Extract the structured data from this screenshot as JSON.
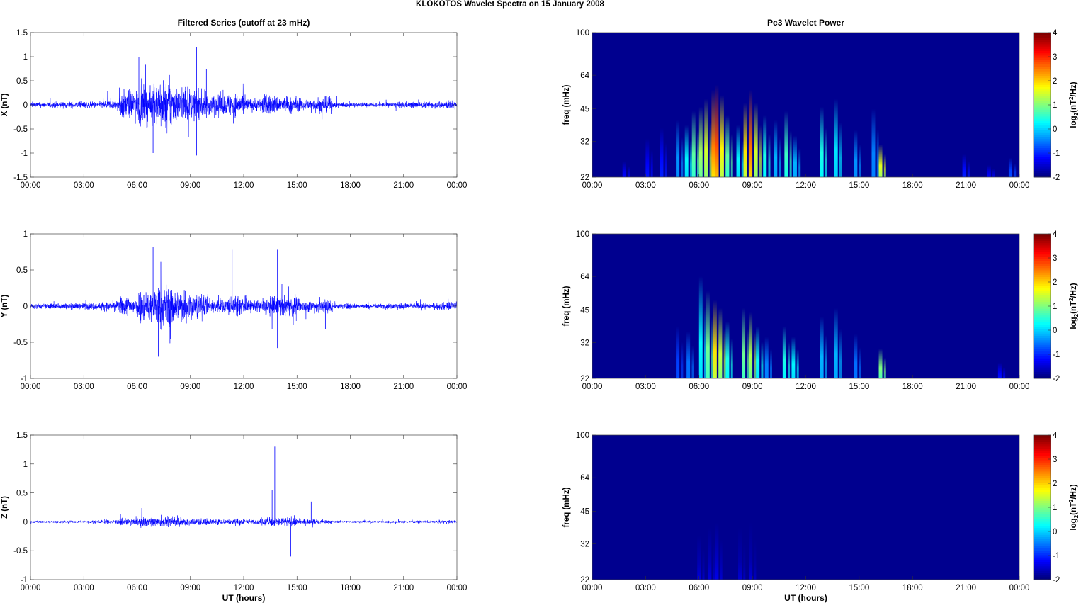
{
  "title": "KLOKOTOS Wavelet Spectra on 15 January   2008",
  "chart_data": [
    {
      "type": "line",
      "title": "Filtered Series (cutoff at 23 mHz)",
      "ylabel": "X (nT)",
      "xlabel": "",
      "ylim": [
        -1.5,
        1.5
      ],
      "yticks": [
        "-1.5",
        "-1",
        "-0.5",
        "0",
        "0.5",
        "1",
        "1.5"
      ],
      "yvals": [
        -1.5,
        -1,
        -0.5,
        0,
        0.5,
        1,
        1.5
      ],
      "xticks": [
        "00:00",
        "03:00",
        "06:00",
        "09:00",
        "12:00",
        "15:00",
        "18:00",
        "21:00",
        "00:00"
      ],
      "envelope_hourly": [
        0.08,
        0.09,
        0.1,
        0.1,
        0.15,
        0.45,
        0.6,
        0.75,
        0.55,
        0.45,
        0.3,
        0.35,
        0.2,
        0.3,
        0.25,
        0.18,
        0.25,
        0.09,
        0.07,
        0.07,
        0.09,
        0.1,
        0.1,
        0.13
      ],
      "spikes": [
        [
          6.1,
          1.0
        ],
        [
          9.35,
          1.2
        ],
        [
          9.35,
          -1.05
        ],
        [
          6.9,
          -1.0
        ],
        [
          9.9,
          0.75
        ]
      ],
      "color": "#0000ff"
    },
    {
      "type": "line",
      "title": "",
      "ylabel": "Y (nT)",
      "xlabel": "",
      "ylim": [
        -1,
        1
      ],
      "yticks": [
        "-1",
        "-0.5",
        "0",
        "0.5",
        "1"
      ],
      "yvals": [
        -1,
        -0.5,
        0,
        0.5,
        1
      ],
      "xticks": [
        "00:00",
        "03:00",
        "06:00",
        "09:00",
        "12:00",
        "15:00",
        "18:00",
        "21:00",
        "00:00"
      ],
      "envelope_hourly": [
        0.05,
        0.06,
        0.06,
        0.07,
        0.1,
        0.2,
        0.35,
        0.45,
        0.35,
        0.25,
        0.15,
        0.2,
        0.12,
        0.2,
        0.22,
        0.12,
        0.15,
        0.06,
        0.05,
        0.05,
        0.06,
        0.06,
        0.06,
        0.08
      ],
      "spikes": [
        [
          6.9,
          0.82
        ],
        [
          11.35,
          0.78
        ],
        [
          13.9,
          0.78
        ],
        [
          7.2,
          -0.7
        ],
        [
          13.9,
          -0.58
        ],
        [
          16.6,
          -0.32
        ]
      ],
      "color": "#0000ff"
    },
    {
      "type": "line",
      "title": "",
      "ylabel": "Z (nT)",
      "xlabel": "UT (hours)",
      "ylim": [
        -1,
        1.5
      ],
      "yticks": [
        "-1",
        "-0.5",
        "0",
        "0.5",
        "1",
        "1.5"
      ],
      "yvals": [
        -1,
        -0.5,
        0,
        0.5,
        1,
        1.5
      ],
      "xticks": [
        "00:00",
        "03:00",
        "06:00",
        "09:00",
        "12:00",
        "15:00",
        "18:00",
        "21:00",
        "00:00"
      ],
      "envelope_hourly": [
        0.03,
        0.03,
        0.03,
        0.04,
        0.05,
        0.08,
        0.12,
        0.12,
        0.1,
        0.09,
        0.07,
        0.08,
        0.06,
        0.12,
        0.12,
        0.07,
        0.05,
        0.03,
        0.03,
        0.03,
        0.03,
        0.03,
        0.03,
        0.04
      ],
      "spikes": [
        [
          13.75,
          1.3
        ],
        [
          13.6,
          0.55
        ],
        [
          14.65,
          -0.6
        ],
        [
          15.8,
          0.35
        ]
      ],
      "color": "#0000ff"
    },
    {
      "type": "heatmap",
      "title": "Pc3 Wavelet Power",
      "ylabel": "freq (mHz)",
      "xlabel": "",
      "colorbar_label": "log2(nT^2/Hz)",
      "clim": [
        -2,
        4
      ],
      "yticks": [
        "22",
        "32",
        "45",
        "64",
        "100"
      ],
      "yvals": [
        22,
        32,
        45,
        64,
        100
      ],
      "cticks": [
        "-2",
        "-1",
        "0",
        "1",
        "2",
        "3",
        "4"
      ],
      "xticks": [
        "00:00",
        "03:00",
        "06:00",
        "09:00",
        "12:00",
        "15:00",
        "18:00",
        "21:00",
        "00:00"
      ],
      "bursts": [
        [
          1.8,
          26,
          -1.4
        ],
        [
          3.1,
          33,
          -1.3
        ],
        [
          3.9,
          37,
          -1.2
        ],
        [
          4.8,
          40,
          -0.4
        ],
        [
          5.3,
          38,
          0.2
        ],
        [
          5.7,
          44,
          0.8
        ],
        [
          6.1,
          46,
          1.2
        ],
        [
          6.4,
          50,
          1.5
        ],
        [
          6.8,
          55,
          2.5
        ],
        [
          7.0,
          58,
          2.8
        ],
        [
          7.3,
          52,
          1.8
        ],
        [
          7.6,
          42,
          0.8
        ],
        [
          8.2,
          38,
          0.2
        ],
        [
          8.6,
          48,
          1.9
        ],
        [
          8.9,
          55,
          2.6
        ],
        [
          9.2,
          48,
          1.5
        ],
        [
          9.7,
          42,
          0.4
        ],
        [
          10.3,
          40,
          -0.2
        ],
        [
          10.9,
          44,
          0.6
        ],
        [
          11.4,
          34,
          -0.2
        ],
        [
          12.9,
          46,
          0.4
        ],
        [
          13.7,
          50,
          0.1
        ],
        [
          14.8,
          36,
          -0.4
        ],
        [
          15.8,
          45,
          -0.5
        ],
        [
          16.2,
          31,
          1.6
        ],
        [
          20.9,
          28,
          -1.2
        ],
        [
          22.3,
          25,
          -1.4
        ],
        [
          23.5,
          27,
          -0.9
        ]
      ]
    },
    {
      "type": "heatmap",
      "title": "",
      "ylabel": "freq (mHz)",
      "xlabel": "",
      "colorbar_label": "log2(nT^2/Hz)",
      "clim": [
        -2,
        4
      ],
      "yticks": [
        "22",
        "32",
        "45",
        "64",
        "100"
      ],
      "yvals": [
        22,
        32,
        45,
        64,
        100
      ],
      "cticks": [
        "-2",
        "-1",
        "0",
        "1",
        "2",
        "3",
        "4"
      ],
      "xticks": [
        "00:00",
        "03:00",
        "06:00",
        "09:00",
        "12:00",
        "15:00",
        "18:00",
        "21:00",
        "00:00"
      ],
      "bursts": [
        [
          4.8,
          38,
          -0.9
        ],
        [
          5.4,
          36,
          -0.6
        ],
        [
          6.1,
          64,
          0.2
        ],
        [
          6.5,
          55,
          0.9
        ],
        [
          6.9,
          50,
          1.9
        ],
        [
          7.2,
          46,
          1.4
        ],
        [
          7.6,
          40,
          0.4
        ],
        [
          8.5,
          46,
          0.9
        ],
        [
          8.9,
          44,
          1.3
        ],
        [
          9.3,
          38,
          0.3
        ],
        [
          9.8,
          34,
          -0.5
        ],
        [
          10.8,
          38,
          0.4
        ],
        [
          11.3,
          34,
          0.2
        ],
        [
          12.9,
          42,
          -0.2
        ],
        [
          13.7,
          46,
          -0.2
        ],
        [
          14.8,
          35,
          -0.6
        ],
        [
          16.2,
          30,
          1.0
        ],
        [
          22.9,
          26,
          -1.3
        ]
      ]
    },
    {
      "type": "heatmap",
      "title": "",
      "ylabel": "freq (mHz)",
      "xlabel": "UT (hours)",
      "colorbar_label": "log2(nT^2/Hz)",
      "clim": [
        -2,
        4
      ],
      "yticks": [
        "22",
        "32",
        "45",
        "64",
        "100"
      ],
      "yvals": [
        22,
        32,
        45,
        64,
        100
      ],
      "cticks": [
        "-2",
        "-1",
        "0",
        "1",
        "2",
        "3",
        "4"
      ],
      "xticks": [
        "00:00",
        "03:00",
        "06:00",
        "09:00",
        "12:00",
        "15:00",
        "18:00",
        "21:00",
        "00:00"
      ],
      "bursts": [
        [
          6.0,
          35,
          -1.7
        ],
        [
          6.6,
          38,
          -1.7
        ],
        [
          7.0,
          40,
          -1.6
        ],
        [
          8.3,
          38,
          -1.75
        ],
        [
          8.9,
          40,
          -1.75
        ]
      ]
    }
  ]
}
